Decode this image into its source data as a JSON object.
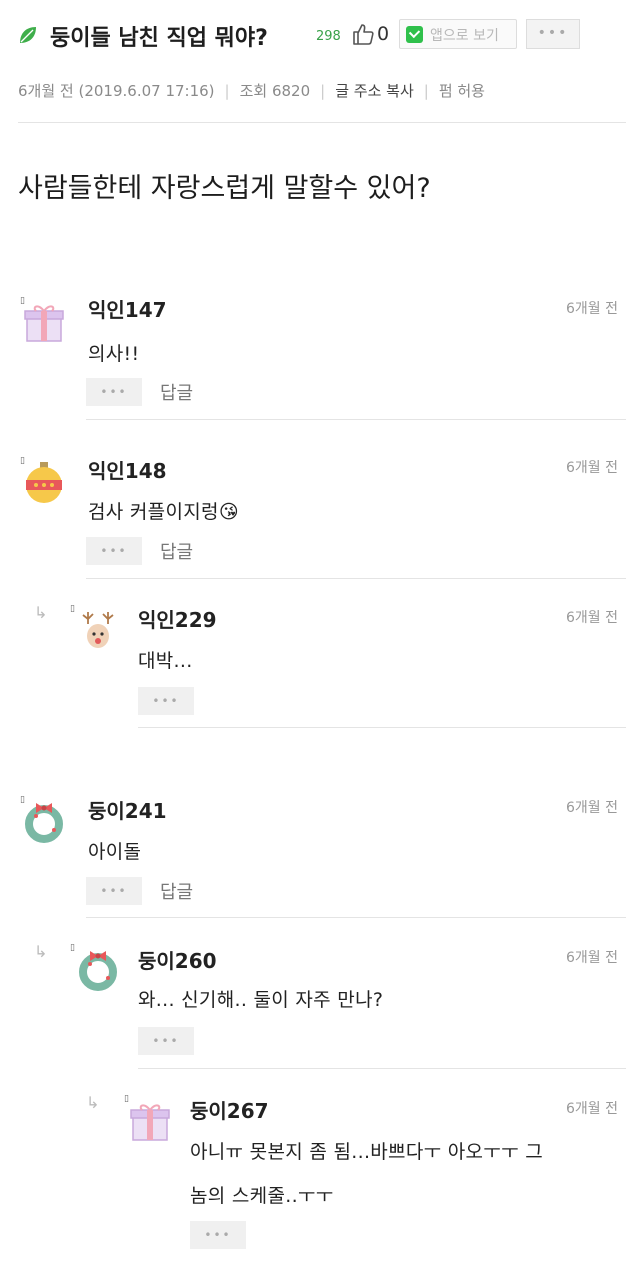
{
  "header": {
    "title": "둥이들 남친 직업 뭐야?",
    "views": "298",
    "likes": "0",
    "app_button": "앱으로 보기",
    "more_button": "•••"
  },
  "meta": {
    "date": "6개월 전 (2019.6.07 17:16)",
    "views": "조회 6820",
    "copy_address": "글 주소 복사",
    "permission": "펌 허용"
  },
  "post": {
    "body": "사람들한테 자랑스럽게 말할수 있어?"
  },
  "comments": [
    {
      "nick": "익인147",
      "time": "6개월 전",
      "text": "의사!!",
      "more": "•••",
      "reply": "답글",
      "avatar": "gift-icon"
    },
    {
      "nick": "익인148",
      "time": "6개월 전",
      "text": "검사 커플이지렁",
      "more": "•••",
      "reply": "답글",
      "avatar": "ornament-icon",
      "emoji": "😘"
    },
    {
      "nick": "익인229",
      "time": "6개월 전",
      "text": "대박...",
      "more": "•••",
      "avatar": "reindeer-icon"
    },
    {
      "nick": "둥이241",
      "time": "6개월 전",
      "text": "아이돌",
      "more": "•••",
      "reply": "답글",
      "avatar": "wreath-icon"
    },
    {
      "nick": "둥이260",
      "time": "6개월 전",
      "text": "와... 신기해.. 둘이 자주 만나?",
      "more": "•••",
      "avatar": "wreath-icon"
    },
    {
      "nick": "둥이267",
      "time": "6개월 전",
      "text": "아니ㅠ 못본지 좀 됨...바쁘다ㅜ 아오ㅜㅜ 그",
      "text2": "놈의 스케줄..ㅜㅜ",
      "more": "•••",
      "avatar": "gift-icon"
    }
  ],
  "colors": {
    "accent_green": "#3aa14a",
    "app_green": "#2fc04b",
    "divider": "#e4e4e4"
  }
}
